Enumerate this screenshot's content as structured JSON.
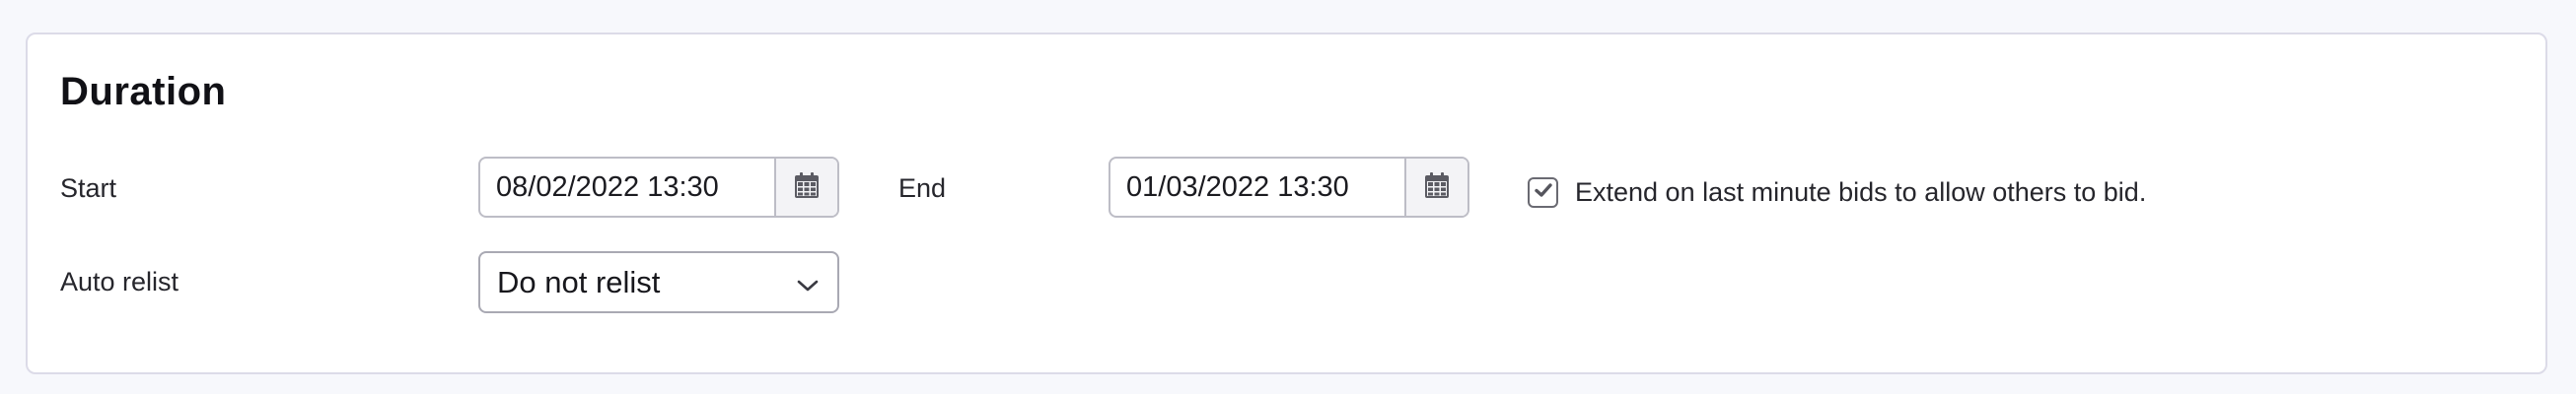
{
  "section": {
    "title": "Duration"
  },
  "start": {
    "label": "Start",
    "value": "08/02/2022 13:30"
  },
  "end": {
    "label": "End",
    "value": "01/03/2022 13:30"
  },
  "extend": {
    "checked": true,
    "label": "Extend on last minute bids to allow others to bid."
  },
  "relist": {
    "label": "Auto relist",
    "selected": "Do not relist"
  },
  "icons": {
    "calendar": "calendar-icon",
    "chevron": "chevron-down-icon",
    "check": "check-icon"
  },
  "colors": {
    "panel_border": "#dcdbe8",
    "input_border": "#bdbdc6",
    "page_bg": "#f7f8fc"
  }
}
